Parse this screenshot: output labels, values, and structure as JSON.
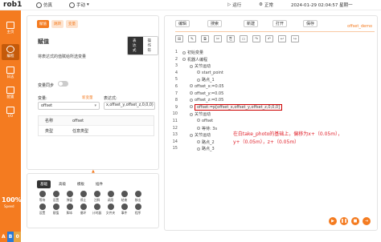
{
  "topbar": {
    "app_title": "rob1",
    "mode_sim": "仿真",
    "mode_manual": "手动",
    "run": "运行",
    "status": "正常",
    "datetime": "2024-01-29 02:04:57 星期一"
  },
  "sidebar": {
    "items": [
      {
        "label": "主页"
      },
      {
        "label": "编程"
      },
      {
        "label": "日志"
      },
      {
        "label": "配置"
      },
      {
        "label": "I/O"
      }
    ],
    "speed_pct": "100%",
    "speed_label": "Speed",
    "keys": [
      "A",
      "B",
      "0"
    ]
  },
  "left": {
    "tabs": [
      "赋值",
      "跳转",
      "变量"
    ],
    "title": "赋值",
    "seg": [
      "表达式",
      "操作符"
    ],
    "hint": "将表达式的值赋给所选变量",
    "toggle_label": "变量同步",
    "var_label": "变量:",
    "new_link": "新变量",
    "expr_label": "表达式:",
    "var_value": "offset",
    "expr_value": "x,offset_y,offset_z,0,0,0)",
    "table": [
      {
        "k": "名称",
        "v": "offset"
      },
      {
        "k": "类型",
        "v": "任意类型"
      }
    ]
  },
  "commands": {
    "tabs": [
      "基础",
      "高级",
      "模板",
      "插件"
    ],
    "items": [
      "等待",
      "设置",
      "弹窗",
      "停止",
      "注释",
      "调用",
      "结束",
      "移出",
      "设置",
      "赋值",
      "脚本",
      "循环",
      "计时器",
      "文件夹",
      "事件",
      "程序"
    ]
  },
  "right": {
    "crumb": "offset_demo",
    "toolbar": [
      "编辑",
      "搜索",
      "新建",
      "打开",
      "保存"
    ],
    "icons": [
      "⊞",
      "✎",
      "⧉",
      "✂",
      "⎘",
      "▭",
      "↷",
      "↶",
      "↩",
      "↪"
    ],
    "lines": [
      {
        "n": "1",
        "t": "初始变量",
        "d": 0
      },
      {
        "n": "2",
        "t": "机器人编程",
        "d": 0
      },
      {
        "n": "3",
        "t": "关节运动",
        "d": 1
      },
      {
        "n": "4",
        "t": "start_point",
        "d": 2
      },
      {
        "n": "5",
        "t": "路点_1",
        "d": 2
      },
      {
        "n": "6",
        "t": "offset_x:=0.05",
        "d": 1
      },
      {
        "n": "7",
        "t": "offset_y:=0.05",
        "d": 1
      },
      {
        "n": "8",
        "t": "offset_z:=0.05",
        "d": 1
      },
      {
        "n": "9",
        "t": "offset:=p[offset_x,offset_y,offset_z,0,0,0]",
        "d": 1,
        "sel": true
      },
      {
        "n": "10",
        "t": "关节运动",
        "d": 1
      },
      {
        "n": "11",
        "t": "offset",
        "d": 2
      },
      {
        "n": "12",
        "t": "等待: 3s",
        "d": 2
      },
      {
        "n": "13",
        "t": "关节运动",
        "d": 1
      },
      {
        "n": "14",
        "t": "路点_2",
        "d": 2
      },
      {
        "n": "15",
        "t": "路点_3",
        "d": 2
      }
    ],
    "annotation": "在白take_photo的基础上，偏移为x+（0.05m），y+（0.05m），z+（0.05m）"
  }
}
